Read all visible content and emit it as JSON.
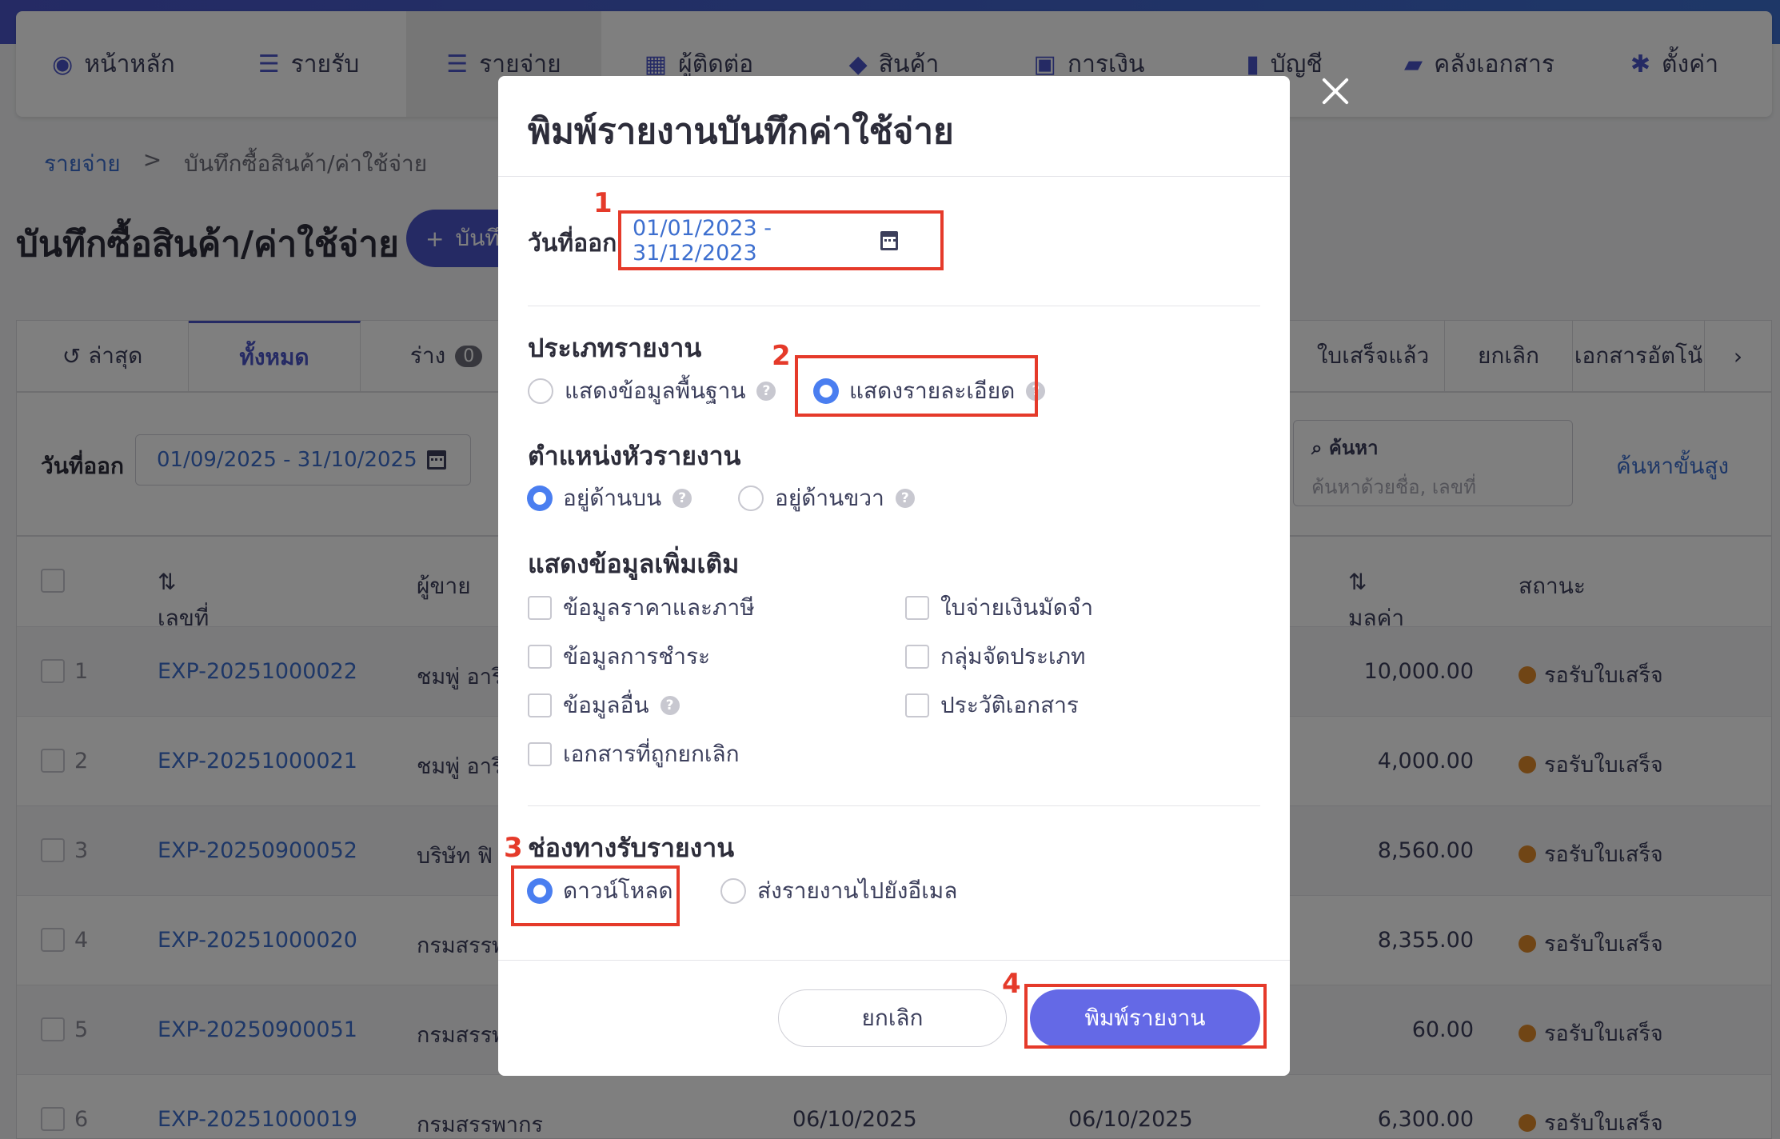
{
  "nav": {
    "items": [
      {
        "label": "หน้าหลัก",
        "icon": "dashboard-icon"
      },
      {
        "label": "รายรับ",
        "icon": "list-icon"
      },
      {
        "label": "รายจ่าย",
        "icon": "list-icon"
      },
      {
        "label": "ผู้ติดต่อ",
        "icon": "contacts-icon"
      },
      {
        "label": "สินค้า",
        "icon": "box-icon"
      },
      {
        "label": "การเงิน",
        "icon": "money-icon"
      },
      {
        "label": "บัญชี",
        "icon": "book-icon"
      },
      {
        "label": "คลังเอกสาร",
        "icon": "folder-icon"
      },
      {
        "label": "ตั้งค่า",
        "icon": "gear-icon"
      }
    ],
    "active_index": 2
  },
  "breadcrumb": {
    "parent": "รายจ่าย",
    "separator": ">",
    "current": "บันทึกซื้อสินค้า/ค่าใช้จ่าย"
  },
  "page": {
    "title": "บันทึกซื้อสินค้า/ค่าใช้จ่าย",
    "add_label": "บันทึ"
  },
  "tabs": {
    "latest": "ล่าสุด",
    "all": "ทั้งหมด",
    "draft": "ร่าง",
    "draft_count": "0",
    "received": "ใบเสร็จแล้ว",
    "cancelled": "ยกเลิก",
    "auto": "เอกสารอัตโนั"
  },
  "filter": {
    "date_label": "วันที่ออก",
    "date_range": "01/09/2025 - 31/10/2025",
    "search_label": "ค้นหา",
    "search_placeholder": "ค้นหาด้วยชื่อ, เลขที่",
    "advanced": "ค้นหาขั้นสูง"
  },
  "table": {
    "headers": {
      "doc_no": "เลขที่เอกสาร",
      "vendor": "ผู้ขาย",
      "net": "มูลค่าสุทธิ",
      "status": "สถานะ"
    },
    "rows": [
      {
        "idx": "1",
        "doc": "EXP-20251000022",
        "vendor": "ชมพู่ อาริ",
        "d1": "",
        "d2": "",
        "amount": "10,000.00",
        "status": "รอรับใบเสร็จ"
      },
      {
        "idx": "2",
        "doc": "EXP-20251000021",
        "vendor": "ชมพู่ อาริ",
        "d1": "",
        "d2": "",
        "amount": "4,000.00",
        "status": "รอรับใบเสร็จ"
      },
      {
        "idx": "3",
        "doc": "EXP-20250900052",
        "vendor": "บริษัท ฟิ",
        "d1": "",
        "d2": "",
        "amount": "8,560.00",
        "status": "รอรับใบเสร็จ"
      },
      {
        "idx": "4",
        "doc": "EXP-20251000020",
        "vendor": "กรมสรรพ",
        "d1": "",
        "d2": "",
        "amount": "8,355.00",
        "status": "รอรับใบเสร็จ"
      },
      {
        "idx": "5",
        "doc": "EXP-20250900051",
        "vendor": "กรมสรรพ",
        "d1": "",
        "d2": "",
        "amount": "60.00",
        "status": "รอรับใบเสร็จ"
      },
      {
        "idx": "6",
        "doc": "EXP-20251000019",
        "vendor": "กรมสรรพากร",
        "d1": "06/10/2025",
        "d2": "06/10/2025",
        "amount": "6,300.00",
        "status": "รอรับใบเสร็จ"
      }
    ]
  },
  "modal": {
    "title": "พิมพ์รายงานบันทึกค่าใช้จ่าย",
    "date_label": "วันที่ออก",
    "date_range": "01/01/2023 - 31/12/2023",
    "report_type": {
      "title": "ประเภทรายงาน",
      "basic": "แสดงข้อมูลพื้นฐาน",
      "detailed": "แสดงรายละเอียด",
      "selected": "detailed"
    },
    "header_position": {
      "title": "ตำแหน่งหัวรายงาน",
      "top": "อยู่ด้านบน",
      "right": "อยู่ด้านขวา",
      "selected": "top"
    },
    "extra_info": {
      "title": "แสดงข้อมูลเพิ่มเติม",
      "price_tax": "ข้อมูลราคาและภาษี",
      "deposit": "ใบจ่ายเงินมัดจำ",
      "payment": "ข้อมูลการชำระ",
      "category": "กลุ่มจัดประเภท",
      "other": "ข้อมูลอื่น",
      "history": "ประวัติเอกสาร",
      "cancelled_docs": "เอกสารที่ถูกยกเลิก"
    },
    "channel": {
      "title": "ช่องทางรับรายงาน",
      "download": "ดาวน์โหลด",
      "email": "ส่งรายงานไปยังอีเมล",
      "selected": "download"
    },
    "cancel_label": "ยกเลิก",
    "print_label": "พิมพ์รายงาน"
  },
  "annotations": {
    "n1": "1",
    "n2": "2",
    "n3": "3",
    "n4": "4",
    "color": "#e53a2a"
  }
}
